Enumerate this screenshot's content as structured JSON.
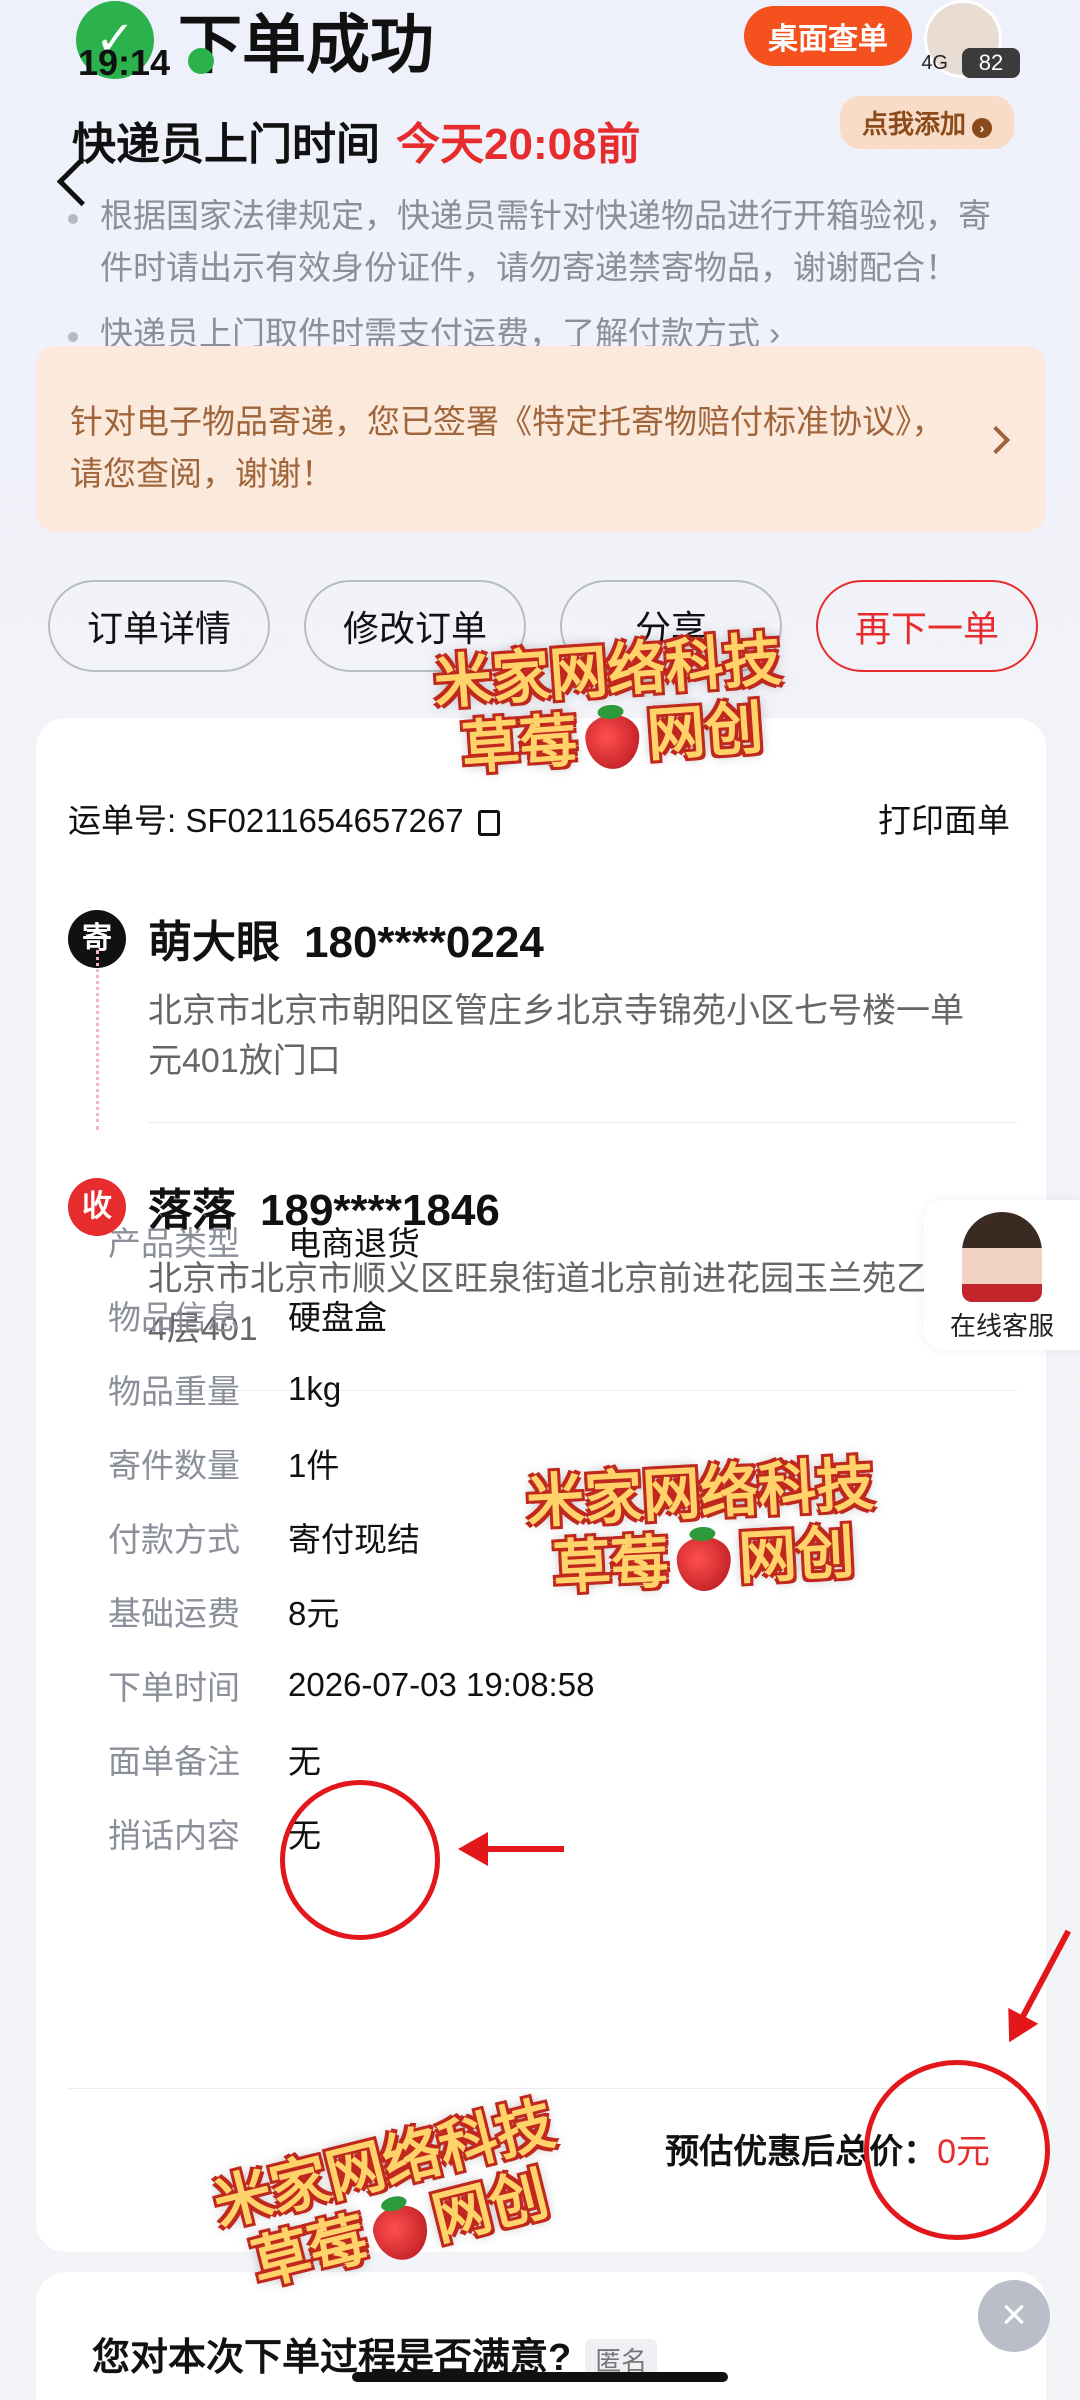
{
  "status_bar": {
    "time": "19:14",
    "network": "4G",
    "battery": "82"
  },
  "header": {
    "title": "下单成功",
    "desk_badge": "桌面查单",
    "add_pill": "点我添加"
  },
  "pickup": {
    "label": "快递员上门时间",
    "deadline": "今天20:08前"
  },
  "notes": [
    "根据国家法律规定，快递员需针对快递物品进行开箱验视，寄件时请出示有效身份证件，请勿寄递禁寄物品，谢谢配合！",
    "快递员上门取件时需支付运费，了解付款方式 ›"
  ],
  "notice": "针对电子物品寄递，您已签署《特定托寄物赔付标准协议》，请您查阅，谢谢！",
  "actions": {
    "order_detail": "订单详情",
    "modify_order": "修改订单",
    "share": "分享",
    "reorder": "再下一单"
  },
  "waybill": {
    "label": "运单号: SF0211654657267",
    "print": "打印面单"
  },
  "sender": {
    "tag": "寄",
    "name": "萌大眼",
    "phone": "180****0224",
    "address": "北京市北京市朝阳区管庄乡北京寺锦苑小区七号楼一单元401放门口"
  },
  "receiver": {
    "tag": "收",
    "name": "落落",
    "phone": "189****1846",
    "address": "北京市北京市顺义区旺泉街道北京前进花园玉兰苑乙楼4层401"
  },
  "details": [
    {
      "k": "产品类型",
      "v": "电商退货"
    },
    {
      "k": "物品信息",
      "v": "硬盘盒"
    },
    {
      "k": "物品重量",
      "v": "1kg"
    },
    {
      "k": "寄件数量",
      "v": "1件"
    },
    {
      "k": "付款方式",
      "v": "寄付现结"
    },
    {
      "k": "基础运费",
      "v": "8元"
    },
    {
      "k": "下单时间",
      "v": "2026-07-03 19:08:58"
    },
    {
      "k": "面单备注",
      "v": "无"
    },
    {
      "k": "捎话内容",
      "v": "无"
    }
  ],
  "total": {
    "label": "预估优惠后总价：",
    "amount": "0元"
  },
  "service": {
    "label": "在线客服"
  },
  "survey": {
    "question": "您对本次下单过程是否满意?",
    "anon": "匿名"
  },
  "watermark": {
    "line1": "米家网络科技",
    "line2a": "草莓",
    "line2b": "网创"
  },
  "colors": {
    "accent_red": "#e62c2c",
    "success_green": "#2bb24c",
    "notice_bg": "#fbe9dc"
  }
}
